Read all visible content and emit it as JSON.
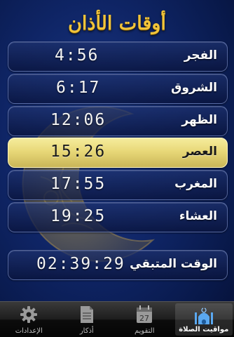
{
  "title": "أوقات الأذان",
  "prayers": [
    {
      "name": "الفجر",
      "time": "4:56"
    },
    {
      "name": "الشروق",
      "time": "6:17"
    },
    {
      "name": "الظهر",
      "time": "12:06"
    },
    {
      "name": "العصر",
      "time": "15:26"
    },
    {
      "name": "المغرب",
      "time": "17:55"
    },
    {
      "name": "العشاء",
      "time": "19:25"
    }
  ],
  "active_index": 3,
  "remaining": {
    "label": "الوقت المتبقي",
    "time": "02:39:29"
  },
  "tabs": [
    {
      "label": "الإعدادات",
      "icon": "gear-icon"
    },
    {
      "label": "أذكار",
      "icon": "document-icon"
    },
    {
      "label": "التقويم",
      "icon": "calendar-icon",
      "icon_text": "27"
    },
    {
      "label": "مواقيت الصلاة",
      "icon": "mosque-icon"
    }
  ],
  "selected_tab": 3,
  "colors": {
    "title": "#f2c43a",
    "active_row": "#e8d878",
    "background": "#0f2566"
  }
}
